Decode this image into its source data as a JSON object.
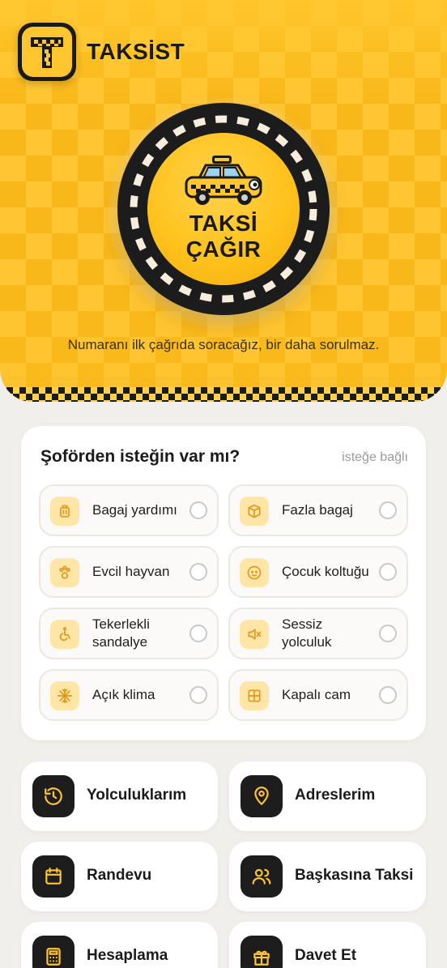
{
  "app": {
    "brand": "TAKSİST"
  },
  "hero": {
    "call_button_label": "TAKSİ ÇAĞIR",
    "note": "Numaranı ilk çağrıda soracağız, bir daha sorulmaz."
  },
  "preferences": {
    "title": "Şoförden isteğin var mı?",
    "optional_label": "isteğe bağlı",
    "options": [
      {
        "label": "Bagaj yardımı",
        "icon": "luggage-icon",
        "selected": false
      },
      {
        "label": "Fazla bagaj",
        "icon": "box-icon",
        "selected": false
      },
      {
        "label": "Evcil hayvan",
        "icon": "paw-icon",
        "selected": false
      },
      {
        "label": "Çocuk koltuğu",
        "icon": "baby-icon",
        "selected": false
      },
      {
        "label": "Tekerlekli sandalye",
        "icon": "wheelchair-icon",
        "selected": false
      },
      {
        "label": "Sessiz yolculuk",
        "icon": "mute-icon",
        "selected": false
      },
      {
        "label": "Açık klima",
        "icon": "snowflake-icon",
        "selected": false
      },
      {
        "label": "Kapalı cam",
        "icon": "window-icon",
        "selected": false
      }
    ]
  },
  "menu": {
    "tiles": [
      {
        "label": "Yolculuklarım",
        "icon": "history-icon"
      },
      {
        "label": "Adreslerim",
        "icon": "location-pin-icon"
      },
      {
        "label": "Randevu",
        "icon": "calendar-icon"
      },
      {
        "label": "Başkasına Taksi",
        "icon": "users-icon"
      },
      {
        "label": "Hesaplama",
        "icon": "calculator-icon"
      },
      {
        "label": "Davet Et",
        "icon": "gift-icon"
      }
    ]
  },
  "colors": {
    "brand_yellow": "#ffc62f",
    "dark": "#1d1d1d",
    "icon_bg": "#ffe6a6",
    "accent_orange": "#e0971a"
  }
}
